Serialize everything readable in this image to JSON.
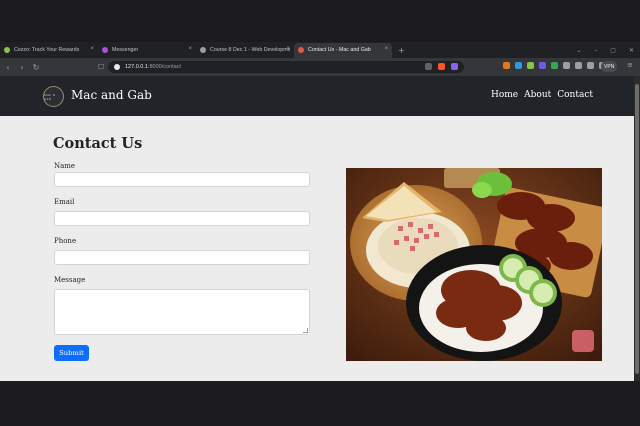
{
  "browser": {
    "tabs": [
      {
        "title": "Cezzo: Track Your Rewards",
        "favicon_color": "#8bc34a",
        "active": false
      },
      {
        "title": "Messenger",
        "favicon_color": "#b44fd6",
        "active": false
      },
      {
        "title": "Course 8 Dec 1 - Web Developme...",
        "favicon_color": "#9aa0a6",
        "active": false
      },
      {
        "title": "Contact Us - Mac and Gab",
        "favicon_color": "#e05d44",
        "active": true
      }
    ],
    "new_tab_glyph": "+",
    "url_host": "127.0.0.1",
    "url_path": ":8000/contact",
    "vpn_label": "VPN",
    "window_controls": [
      "⌄",
      "–",
      "▢",
      "✕"
    ]
  },
  "site": {
    "brand": "Mac and Gab",
    "logo_text": "MAC & GAB",
    "nav": [
      "Home",
      "About",
      "Contact"
    ]
  },
  "contact": {
    "title": "Contact Us",
    "fields": {
      "name_label": "Name",
      "email_label": "Email",
      "phone_label": "Phone",
      "message_label": "Message"
    },
    "submit_label": "Submit"
  },
  "colors": {
    "navbar": "#212529",
    "page_bg": "#ececec",
    "submit": "#0d6efd"
  },
  "icons": {
    "back": "arrow-left-icon",
    "forward": "arrow-right-icon",
    "reload": "reload-icon",
    "bookmark": "bookmark-icon",
    "site_info": "site-info-icon"
  }
}
